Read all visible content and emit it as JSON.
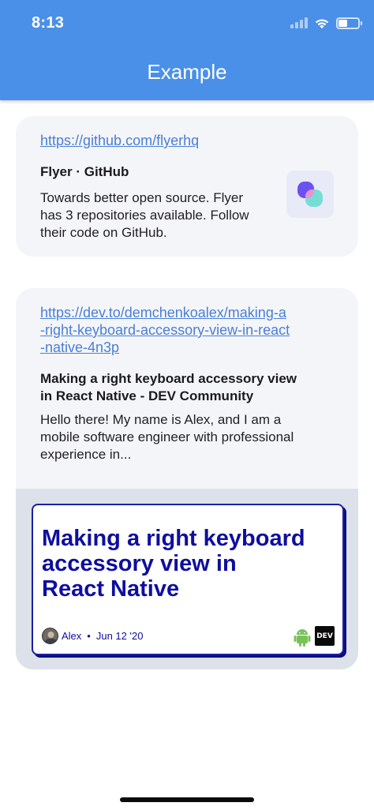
{
  "status_bar": {
    "time": "8:13"
  },
  "header": {
    "title": "Example"
  },
  "colors": {
    "header": "#4a90e8",
    "card": "#f4f5f9",
    "link": "#4a7fd6",
    "dev_blue": "#0e0ea0"
  },
  "previews": [
    {
      "url_lines": [
        "https://github.com/flyerhq"
      ],
      "title_lines": [
        "Flyer · GitHub"
      ],
      "description_lines": [
        "Towards better open source. Flyer",
        "has 3 repositories available. Follow",
        "their code on GitHub."
      ],
      "thumbnail_icon": "flyer-logo-icon"
    },
    {
      "url_lines": [
        "https://dev.to/demchenkoalex/making-a",
        "-right-keyboard-accessory-view-in-react",
        "-native-4n3p"
      ],
      "title_lines": [
        "Making a right keyboard accessory view",
        "in React Native - DEV Community"
      ],
      "description_lines": [
        "Hello there!  My name is Alex, and I am a",
        "mobile software engineer with professional",
        "experience in..."
      ],
      "image": {
        "title_lines": [
          "Making a right keyboard",
          "accessory view in",
          "React Native"
        ],
        "author": "Alex",
        "separator": "•",
        "date": "Jun 12 '20",
        "badge": "DEV"
      }
    }
  ]
}
